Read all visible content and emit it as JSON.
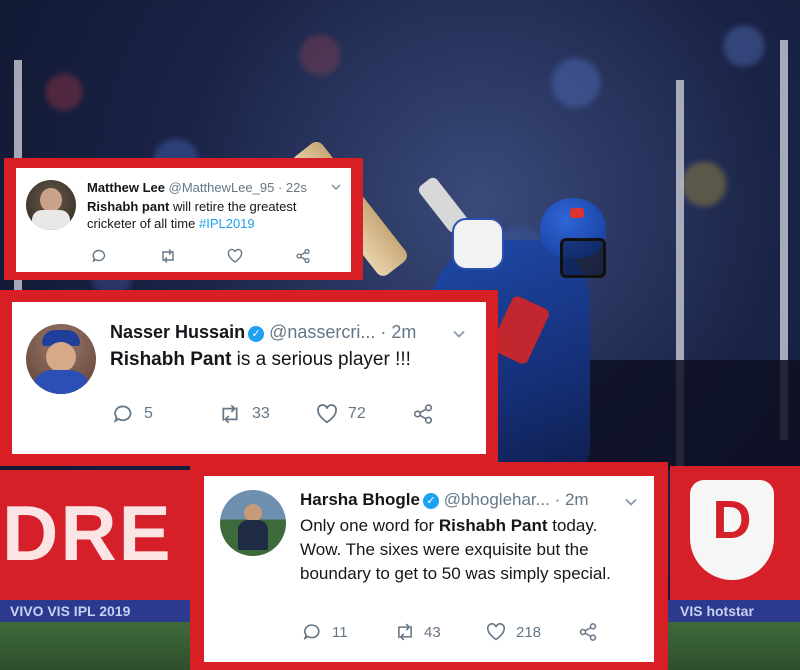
{
  "background": {
    "sponsor_left": "DRE",
    "sponsor_right_letter": "D",
    "strip_left": "VIVO VIS IPL 2019",
    "strip_right": "VIS hotstar"
  },
  "tweets": [
    {
      "name": "Matthew Lee",
      "handle": "@MatthewLee_95",
      "time": "· 22s",
      "text_bold": "Rishabh pant",
      "text_main": " will retire the greatest cricketer of all time ",
      "hashtag": "#IPL2019",
      "replies": "",
      "retweets": "",
      "likes": ""
    },
    {
      "name": "Nasser Hussain",
      "handle": "@nassercri...",
      "time": "· 2m",
      "text_bold": "Rishabh Pant",
      "text_main": " is a serious player !!!",
      "replies": "5",
      "retweets": "33",
      "likes": "72"
    },
    {
      "name": "Harsha Bhogle",
      "handle": "@bhoglehar...",
      "time": "· 2m",
      "text_pre": "Only one word for ",
      "text_bold": "Rishabh Pant",
      "text_main": " today. Wow. The sixes were exquisite but the boundary to get to 50 was simply special.",
      "replies": "11",
      "retweets": "43",
      "likes": "218"
    }
  ],
  "colors": {
    "frame_red": "#d91f26",
    "link_blue": "#1da1f2",
    "muted": "#657786"
  }
}
